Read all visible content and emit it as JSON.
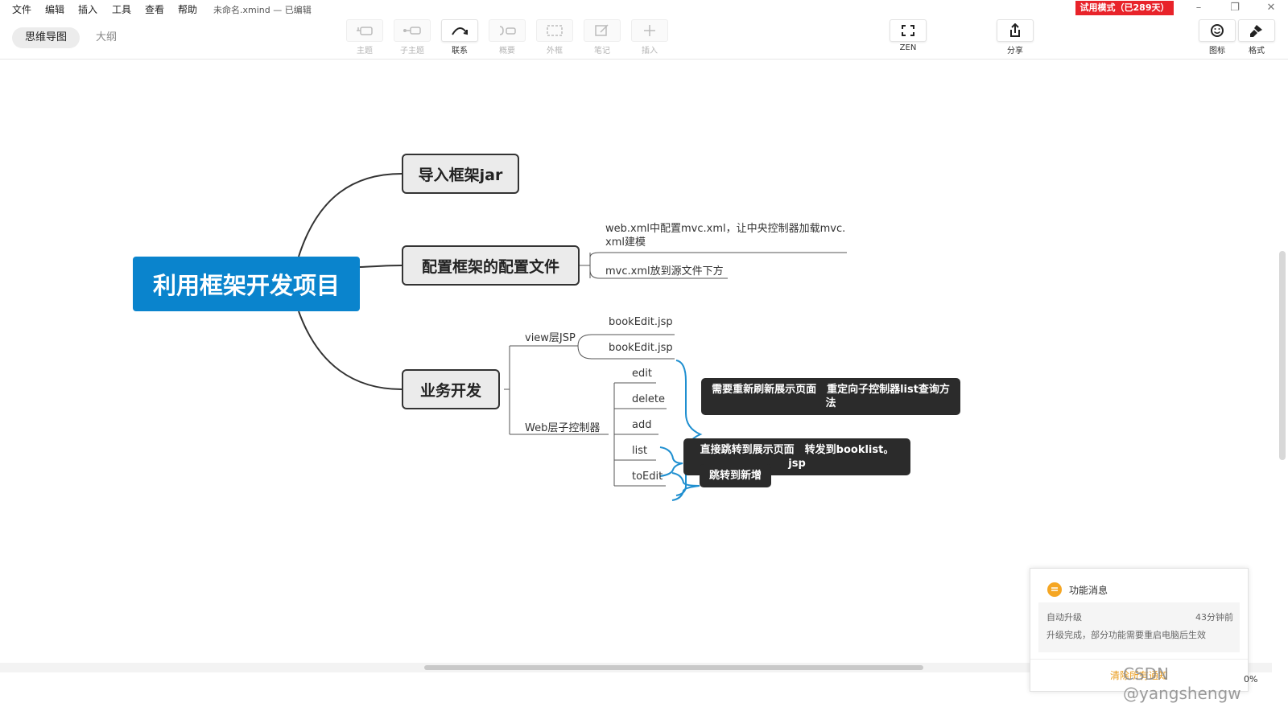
{
  "menu": [
    "文件",
    "编辑",
    "插入",
    "工具",
    "查看",
    "帮助"
  ],
  "window": {
    "title": "未命名.xmind — 已编辑",
    "trial_badge": "试用模式（已289天）"
  },
  "view_tabs": {
    "mindmap": "思维导图",
    "outline": "大纲"
  },
  "toolbar": {
    "topic": "主题",
    "subtopic": "子主题",
    "relationship": "联系",
    "summary": "概要",
    "boundary": "外框",
    "note": "笔记",
    "insert": "插入",
    "zen": "ZEN",
    "share": "分享",
    "icon": "图标",
    "format": "格式"
  },
  "mindmap": {
    "central": "利用框架开发项目",
    "branch1": "导入框架jar",
    "branch2": "配置框架的配置文件",
    "branch2_children": [
      "web.xml中配置mvc.xml，让中央控制器加载mvc.",
      "xml建模",
      "mvc.xml放到源文件下方"
    ],
    "branch3": "业务开发",
    "view_layer": "view层JSP",
    "view_children": [
      "bookEdit.jsp",
      "bookEdit.jsp"
    ],
    "web_layer": "Web层子控制器",
    "web_children": [
      "edit",
      "delete",
      "add",
      "list",
      "toEdit"
    ],
    "notes": {
      "crud": "需要重新刷新展示页面　重定向子控制器list查询方法",
      "list": "直接跳转到展示页面　转发到booklist。jsp",
      "toEdit": "跳转到新增"
    }
  },
  "notification": {
    "title": "功能消息",
    "item_title": "自动升级",
    "item_time": "43分钟前",
    "item_text": "升级完成，部分功能需要重启电脑后生效",
    "action": "清除所有通知"
  },
  "watermark": "CSDN @yangshengw",
  "zoom": "0%",
  "colors": {
    "accent": "#0a84cd",
    "trial": "#e8232a",
    "note_bg": "#2b2b2b",
    "brace": "#1f8fd0"
  }
}
